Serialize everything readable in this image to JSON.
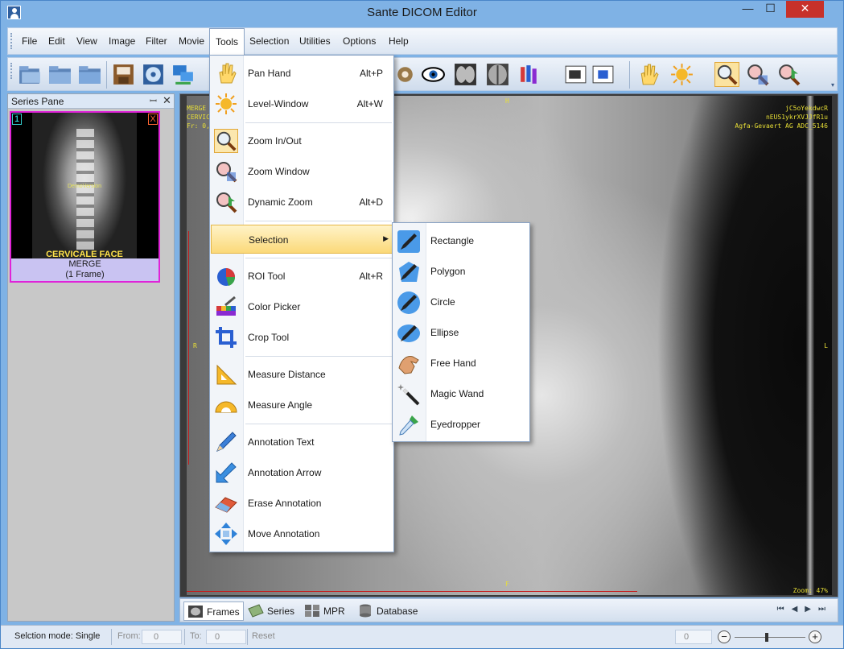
{
  "window": {
    "title": "Sante DICOM Editor",
    "minimize": "—",
    "maximize": "☐",
    "close": "✕"
  },
  "menubar": {
    "items": [
      {
        "label": "File"
      },
      {
        "label": "Edit"
      },
      {
        "label": "View"
      },
      {
        "label": "Image"
      },
      {
        "label": "Filter"
      },
      {
        "label": "Movie"
      },
      {
        "label": "Tools"
      },
      {
        "label": "Selection"
      },
      {
        "label": "Utilities"
      },
      {
        "label": "Options"
      },
      {
        "label": "Help"
      }
    ]
  },
  "toolbar": {
    "chevron": "▾"
  },
  "series_pane": {
    "title": "Series Pane",
    "pin": "ꟷ",
    "close": "✕",
    "thumb": {
      "number": "1",
      "remove": "X",
      "label": "CERVICALE FACE",
      "watermark": "DemoVersion",
      "caption_name": "MERGE",
      "caption_frames": "(1 Frame)"
    }
  },
  "viewer": {
    "overlay_tl": [
      "MERGE",
      "CERVIC",
      "Fr: 0, \\"
    ],
    "overlay_tr": [
      "jC5oYekdwcR",
      "nEUS1ykrXVJJfR1u",
      "Agfa-Gevaert AG ADC_5146"
    ],
    "marker_top": "H",
    "marker_right": "R",
    "marker_left": "L",
    "marker_bottom": "F",
    "zoom": "Zoom: 47%",
    "watermark": "rsion"
  },
  "tabs": [
    {
      "label": "Frames"
    },
    {
      "label": "Series"
    },
    {
      "label": "MPR"
    },
    {
      "label": "Database"
    }
  ],
  "nav_arrows": "⏮◀▶⏭",
  "status": {
    "mode": "Selction mode: Single",
    "from_label": "From:",
    "from_value": "0",
    "to_label": "To:",
    "to_value": "0",
    "reset": "Reset",
    "zoom_value": "0",
    "minus": "−",
    "plus": "+"
  },
  "tools_menu": {
    "items": [
      {
        "label": "Pan Hand",
        "shortcut": "Alt+P",
        "icon": "hand-icon"
      },
      {
        "label": "Level-Window",
        "shortcut": "Alt+W",
        "icon": "sun-icon"
      },
      {
        "label": "Zoom In/Out",
        "shortcut": "",
        "icon": "magnifier-icon"
      },
      {
        "label": "Zoom Window",
        "shortcut": "",
        "icon": "zoom-window-icon"
      },
      {
        "label": "Dynamic Zoom",
        "shortcut": "Alt+D",
        "icon": "dynamic-zoom-icon"
      },
      {
        "label": "Selection",
        "shortcut": "",
        "icon": "selection-icon"
      },
      {
        "label": "ROI Tool",
        "shortcut": "Alt+R",
        "icon": "roi-icon"
      },
      {
        "label": "Color Picker",
        "shortcut": "",
        "icon": "color-picker-icon"
      },
      {
        "label": "Crop Tool",
        "shortcut": "",
        "icon": "crop-icon"
      },
      {
        "label": "Measure Distance",
        "shortcut": "",
        "icon": "ruler-triangle-icon"
      },
      {
        "label": "Measure Angle",
        "shortcut": "",
        "icon": "protractor-icon"
      },
      {
        "label": "Annotation Text",
        "shortcut": "",
        "icon": "pencil-icon"
      },
      {
        "label": "Annotation Arrow",
        "shortcut": "",
        "icon": "arrow-icon"
      },
      {
        "label": "Erase Annotation",
        "shortcut": "",
        "icon": "eraser-icon"
      },
      {
        "label": "Move Annotation",
        "shortcut": "",
        "icon": "move-icon"
      }
    ],
    "submenu_arrow": "▶"
  },
  "selection_menu": {
    "items": [
      {
        "label": "Rectangle",
        "icon": "pen-rectangle-icon"
      },
      {
        "label": "Polygon",
        "icon": "pen-polygon-icon"
      },
      {
        "label": "Circle",
        "icon": "pen-circle-icon"
      },
      {
        "label": "Ellipse",
        "icon": "pen-ellipse-icon"
      },
      {
        "label": "Free Hand",
        "icon": "free-hand-icon"
      },
      {
        "label": "Magic Wand",
        "icon": "magic-wand-icon"
      },
      {
        "label": "Eyedropper",
        "icon": "eyedropper-icon"
      }
    ]
  },
  "colors": {
    "accent": "#7fb2e5",
    "highlight": "#fbd979",
    "overlay_text": "#e8df36",
    "thumb_border": "#e024d8"
  }
}
